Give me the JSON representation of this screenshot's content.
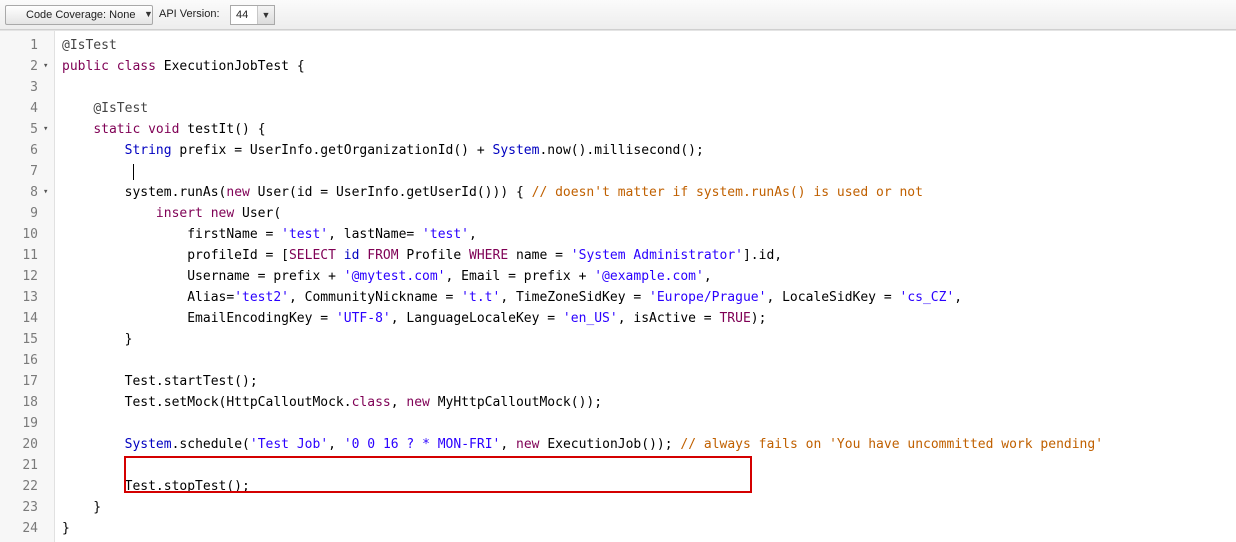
{
  "toolbar": {
    "code_coverage_label": "Code Coverage: None",
    "api_version_label": "API Version:",
    "api_version_value": "44"
  },
  "editor": {
    "lines": [
      {
        "num": "1",
        "text": "@IsTest"
      },
      {
        "num": "2",
        "text": "public class ExecutionJobTest {"
      },
      {
        "num": "3",
        "text": ""
      },
      {
        "num": "4",
        "text": "    @IsTest"
      },
      {
        "num": "5",
        "text": "    static void testIt() {"
      },
      {
        "num": "6",
        "text": "        String prefix = UserInfo.getOrganizationId() + System.now().millisecond();"
      },
      {
        "num": "7",
        "text": ""
      },
      {
        "num": "8",
        "text": "        system.runAs(new User(id = UserInfo.getUserId())) { // doesn't matter if system.runAs() is used or not"
      },
      {
        "num": "9",
        "text": "            insert new User("
      },
      {
        "num": "10",
        "text": "                firstName = 'test', lastName= 'test',"
      },
      {
        "num": "11",
        "text": "                profileId = [SELECT id FROM Profile WHERE name = 'System Administrator'].id,"
      },
      {
        "num": "12",
        "text": "                Username = prefix + '@mytest.com', Email = prefix + '@example.com',"
      },
      {
        "num": "13",
        "text": "                Alias='test2', CommunityNickname = 't.t', TimeZoneSidKey = 'Europe/Prague', LocaleSidKey = 'cs_CZ',"
      },
      {
        "num": "14",
        "text": "                EmailEncodingKey = 'UTF-8', LanguageLocaleKey = 'en_US', isActive = TRUE);"
      },
      {
        "num": "15",
        "text": "        }"
      },
      {
        "num": "16",
        "text": ""
      },
      {
        "num": "17",
        "text": "        Test.startTest();"
      },
      {
        "num": "18",
        "text": "        Test.setMock(HttpCalloutMock.class, new MyHttpCalloutMock());"
      },
      {
        "num": "19",
        "text": ""
      },
      {
        "num": "20",
        "text": "        System.schedule('Test Job', '0 0 16 ? * MON-FRI', new ExecutionJob()); // always fails on 'You have uncommitted work pending'"
      },
      {
        "num": "21",
        "text": ""
      },
      {
        "num": "22",
        "text": "        Test.stopTest();"
      },
      {
        "num": "23",
        "text": "    }"
      },
      {
        "num": "24",
        "text": "}"
      }
    ],
    "fold_markers": [
      "2",
      "5",
      "8"
    ],
    "caret_line": "7"
  },
  "colors": {
    "keyword": "#7f0055",
    "system_class": "#0000c0",
    "string": "#2a00ff",
    "comment": "#c06000",
    "highlight_border": "#d40000"
  }
}
